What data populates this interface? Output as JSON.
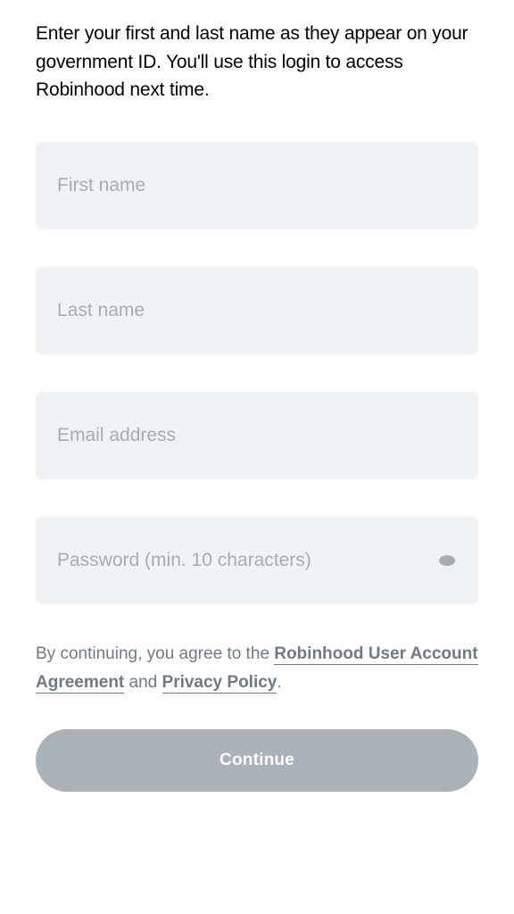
{
  "instruction": "Enter your first and last name as they appear on your government ID. You'll use this login to access Robinhood next time.",
  "fields": {
    "first_name": {
      "placeholder": "First name",
      "value": ""
    },
    "last_name": {
      "placeholder": "Last name",
      "value": ""
    },
    "email": {
      "placeholder": "Email address",
      "value": ""
    },
    "password": {
      "placeholder": "Password (min. 10 characters)",
      "value": ""
    }
  },
  "legal": {
    "prefix": "By continuing, you agree to the ",
    "agreement_link": "Robinhood User Account Agreement",
    "conjunction": " and ",
    "privacy_link": "Privacy Policy",
    "suffix": "."
  },
  "continue_label": "Continue"
}
